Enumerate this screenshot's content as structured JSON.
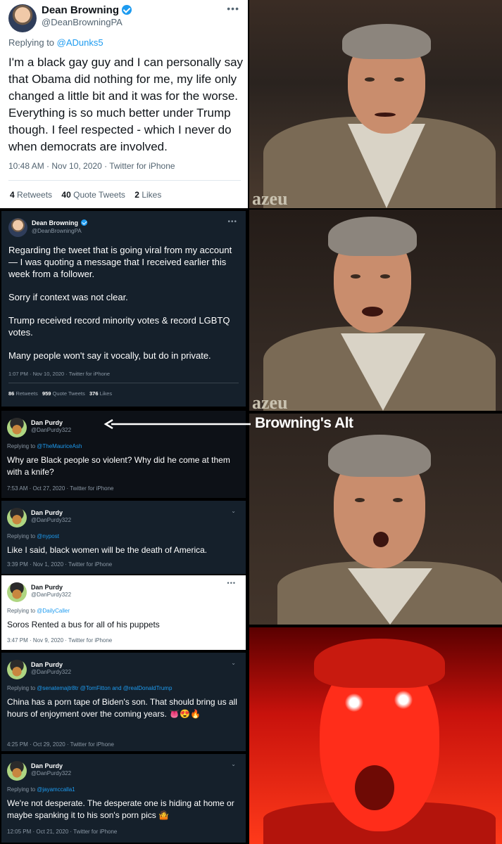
{
  "tweet1": {
    "name": "Dean Browning",
    "handle": "@DeanBrowningPA",
    "reply_prefix": "Replying to ",
    "reply_to": "@ADunks5",
    "body": "I'm a black gay guy and I can personally say that Obama did nothing for me, my life only changed a little bit and it was for the worse. Everything is so much better under Trump though. I feel respected - which I never do when democrats are involved.",
    "meta": "10:48 AM · Nov 10, 2020 · Twitter for iPhone",
    "retweets_count": "4",
    "retweets_label": "Retweets",
    "quotes_count": "40",
    "quotes_label": "Quote Tweets",
    "likes_count": "2",
    "likes_label": "Likes"
  },
  "tweet2": {
    "name": "Dean Browning",
    "handle": "@DeanBrowningPA",
    "p1": "Regarding the tweet that is going viral from my account — I was quoting a message that I received earlier this week from a follower.",
    "p2": "Sorry if context was not clear.",
    "p3": "Trump received record minority votes & record LGBTQ votes.",
    "p4": "Many people won't say it vocally, but do in private.",
    "meta": "1:07 PM · Nov 10, 2020 · Twitter for iPhone",
    "retweets_count": "86",
    "retweets_label": "Retweets",
    "quotes_count": "959",
    "quotes_label": "Quote Tweets",
    "likes_count": "376",
    "likes_label": "Likes"
  },
  "annotation": {
    "label": "Browning's Alt"
  },
  "alt_tweets": [
    {
      "name": "Dan Purdy",
      "handle": "@DanPurdy322",
      "reply_prefix": "Replying to ",
      "reply_to": "@TheMauriceAsh",
      "body": "Why are Black people so violent? Why did he come at them with a knife?",
      "meta": "7:53 AM · Oct 27, 2020 · Twitter for iPhone"
    },
    {
      "name": "Dan Purdy",
      "handle": "@DanPurdy322",
      "reply_prefix": "Replying to ",
      "reply_to": "@nypost",
      "body": "Like I said, black women will be the death of America.",
      "meta": "3:39 PM · Nov 1, 2020 · Twitter for iPhone"
    },
    {
      "name": "Dan Purdy",
      "handle": "@DanPurdy322",
      "reply_prefix": "Replying to ",
      "reply_to": "@DailyCaller",
      "body": "Soros Rented a bus for all of his puppets",
      "meta": "3:47 PM · Nov 9, 2020 · Twitter for iPhone"
    },
    {
      "name": "Dan Purdy",
      "handle": "@DanPurdy322",
      "reply_prefix": "Replying to ",
      "reply_to": "@senatemajtr8tr @TomFitton and @realDonaldTrump",
      "body": "China has a porn tape of Biden's son. That should bring us all hours of enjoyment over the coming years.",
      "emojis": "👅😍🔥",
      "meta": "4:25 PM · Oct 29, 2020 · Twitter for iPhone"
    },
    {
      "name": "Dan Purdy",
      "handle": "@DanPurdy322",
      "reply_prefix": "Replying to ",
      "reply_to": "@jayamccalla1",
      "body": "We're not desperate. The desperate one is hiding at home or maybe spanking it to his son's porn pics",
      "emojis": "🤷",
      "meta": "12:05 PM · Oct 21, 2020 · Twitter for iPhone"
    }
  ],
  "watermark": "azeu",
  "icons": {
    "more": "more-horizontal-icon",
    "chevron": "chevron-down-icon",
    "verified": "verified-badge-icon"
  },
  "colors": {
    "link": "#1d9bf0",
    "dark_bg": "#15202b",
    "caption": "#ffffff"
  }
}
